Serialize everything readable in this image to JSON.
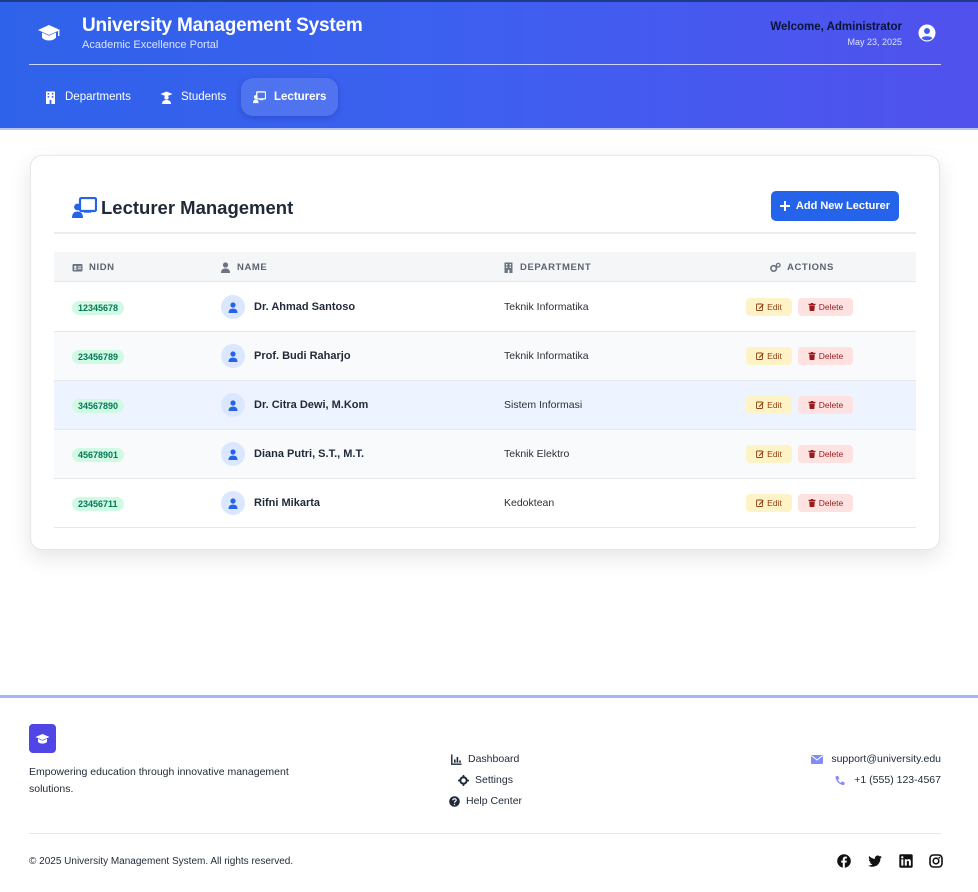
{
  "header": {
    "title": "University Management System",
    "subtitle": "Academic Excellence Portal",
    "welcome": "Welcome, Administrator",
    "date": "May 23, 2025",
    "nav": [
      {
        "label": "Departments",
        "icon": "building-icon"
      },
      {
        "label": "Students",
        "icon": "student-icon"
      },
      {
        "label": "Lecturers",
        "icon": "chalkboard-teacher-icon",
        "active": true
      }
    ]
  },
  "main": {
    "title": "Lecturer Management",
    "add_button": "Add New Lecturer",
    "columns": [
      "NIDN",
      "NAME",
      "DEPARTMENT",
      "ACTIONS"
    ],
    "edit_label": "Edit",
    "delete_label": "Delete",
    "rows": [
      {
        "nidn": "12345678",
        "name": "Dr. Ahmad Santoso",
        "department": "Teknik Informatika"
      },
      {
        "nidn": "23456789",
        "name": "Prof. Budi Raharjo",
        "department": "Teknik Informatika"
      },
      {
        "nidn": "34567890",
        "name": "Dr. Citra Dewi, M.Kom",
        "department": "Sistem Informasi"
      },
      {
        "nidn": "45678901",
        "name": "Diana Putri, S.T., M.T.",
        "department": "Teknik Elektro"
      },
      {
        "nidn": "23456711",
        "name": "Rifni Mikarta",
        "department": "Kedoktean"
      }
    ]
  },
  "footer": {
    "description": "Empowering education through innovative management solutions.",
    "links": [
      "Dashboard",
      "Settings",
      "Help Center"
    ],
    "email": "support@university.edu",
    "phone": "+1 (555) 123-4567",
    "copyright": "© 2025 University Management System. All rights reserved.",
    "social": [
      "facebook-icon",
      "twitter-icon",
      "linkedin-icon",
      "instagram-icon"
    ]
  },
  "colors": {
    "primary": "#2563eb",
    "header_gradient_start": "#2f62ea",
    "header_gradient_end": "#5151ee",
    "nidn_badge_bg": "#d1fae5",
    "edit_bg": "#fef3c7",
    "delete_bg": "#fee2e2"
  }
}
